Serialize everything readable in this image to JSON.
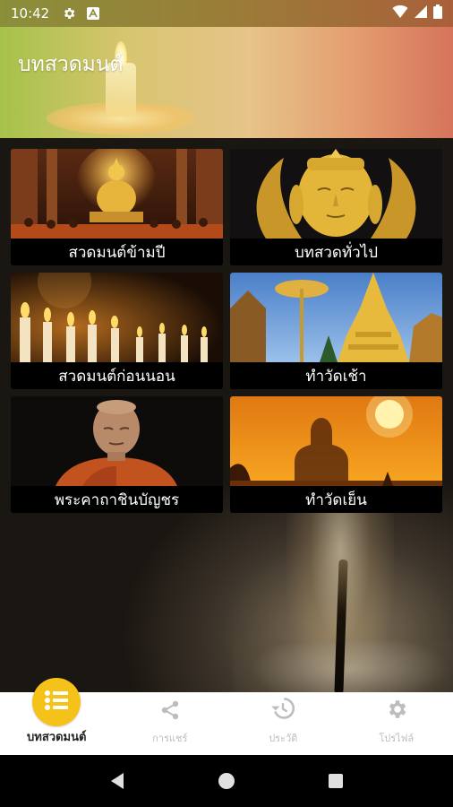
{
  "status_bar": {
    "time": "10:42",
    "icons": [
      "gear-icon",
      "android-a-icon"
    ],
    "right_icons": [
      "wifi-icon",
      "signal-icon",
      "battery-icon"
    ]
  },
  "header": {
    "title": "บทสวดมนต์"
  },
  "tiles": [
    {
      "label": "สวดมนต์ข้ามปี",
      "image": "golden-buddha-temple-interior"
    },
    {
      "label": "บทสวดทั่วไป",
      "image": "golden-buddha-face"
    },
    {
      "label": "สวดมนต์ก่อนนอน",
      "image": "lit-candles"
    },
    {
      "label": "ทำวัดเช้า",
      "image": "golden-pagoda"
    },
    {
      "label": "พระคาถาชินบัญชร",
      "image": "monk-portrait"
    },
    {
      "label": "ทำวัดเย็น",
      "image": "buddha-silhouette-sunset"
    }
  ],
  "bottom_nav": {
    "items": [
      {
        "label": "บทสวดมนต์",
        "icon": "list-icon",
        "active": true
      },
      {
        "label": "การแชร์",
        "icon": "share-icon",
        "active": false
      },
      {
        "label": "ประวัติ",
        "icon": "history-icon",
        "active": false
      },
      {
        "label": "โปรไฟล์",
        "icon": "gear-icon",
        "active": false
      }
    ]
  },
  "system_nav": [
    "back-icon",
    "home-icon",
    "recents-icon"
  ],
  "colors": {
    "accent": "#f5c21a",
    "nav_inactive": "#bdbdbd"
  }
}
